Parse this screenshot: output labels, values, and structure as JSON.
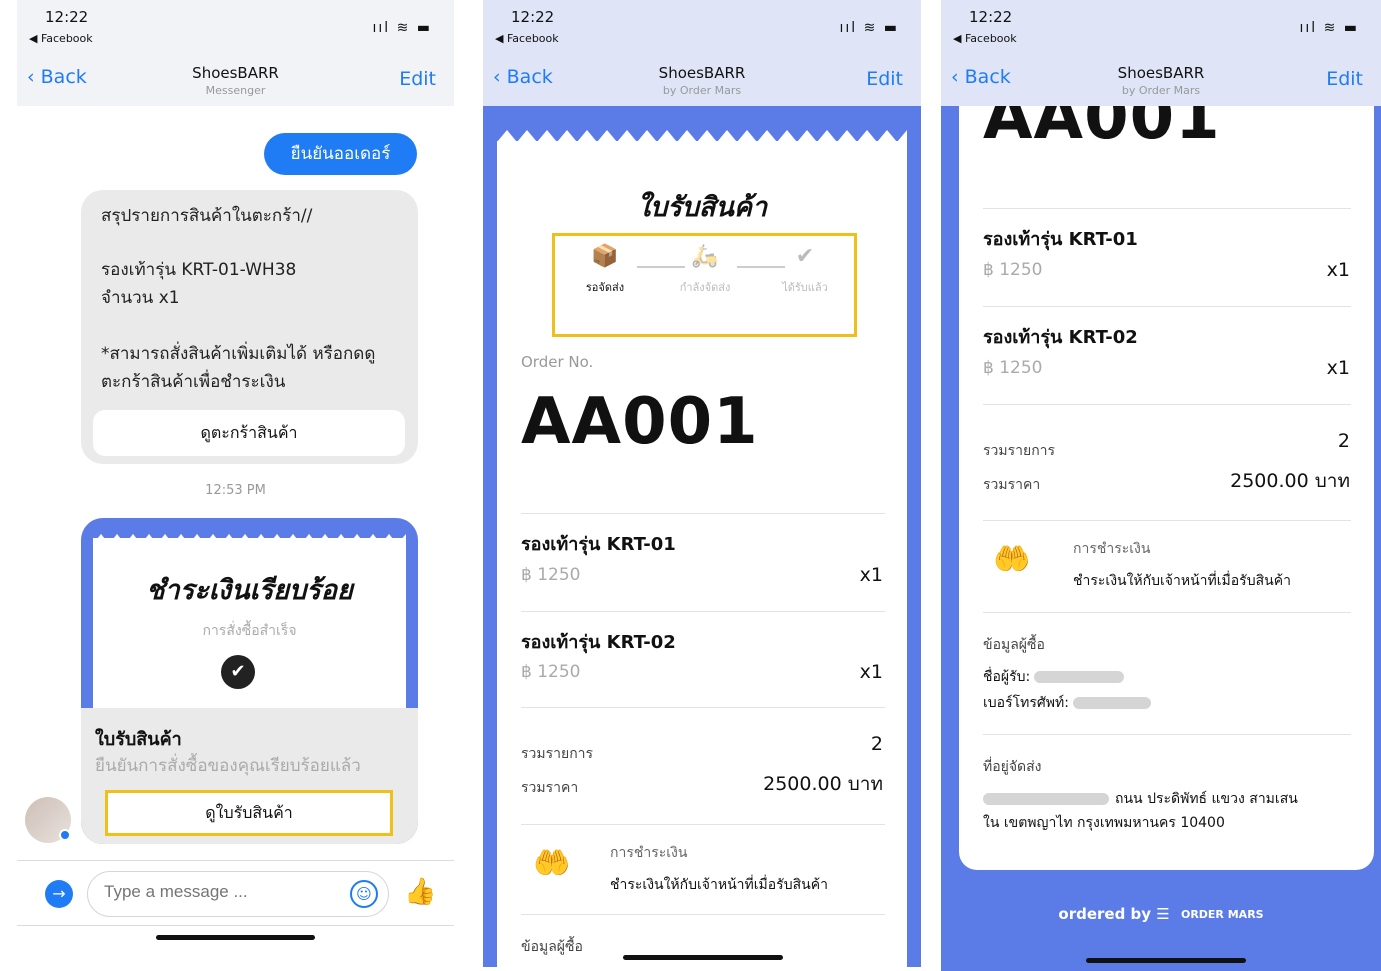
{
  "status": {
    "time": "12:22",
    "back_app": "◀ Facebook",
    "sys_icons": "ııl ≋ ▬"
  },
  "nav": {
    "back": "Back",
    "edit": "Edit",
    "title": "ShoesBARR",
    "sub_messenger": "Messenger",
    "sub_order": "by Order Mars"
  },
  "chat": {
    "sent": "ยืนยันออเดอร์",
    "cart_card": {
      "line1": "สรุปรายการสินค้าในตะกร้า//",
      "line2": "รองเท้ารุ่น KRT-01-WH38",
      "line3": "จำนวน x1",
      "line4": "*สามารถสั่งสินค้าเพิ่มเติมได้ หรือกดดู",
      "line5": "ตะกร้าสินค้าเพื่อชำระเงิน",
      "button": "ดูตะกร้าสินค้า"
    },
    "timestamp": "12:53 PM",
    "receipt_card": {
      "paid": "ชำระเงินเรียบร้อย",
      "paid_sub": "การสั่งซื้อสำเร็จ",
      "title": "ใบรับสินค้า",
      "subtitle": "ยืนยันการสั่งซื้อของคุณเรียบร้อยแล้ว",
      "button": "ดูใบรับสินค้า"
    },
    "input_placeholder": "Type a message ..."
  },
  "receipt": {
    "title": "ใบรับสินค้า",
    "steps": [
      {
        "icon": "box-icon",
        "glyph": "📦",
        "label": "รอจัดส่ง",
        "active": true
      },
      {
        "icon": "scooter-icon",
        "glyph": "🛵",
        "label": "กำลังจัดส่ง",
        "active": false
      },
      {
        "icon": "check-icon",
        "glyph": "✔",
        "label": "ได้รับแล้ว",
        "active": false
      }
    ],
    "order_label": "Order No.",
    "order_no": "AA001",
    "items": [
      {
        "name": "รองเท้ารุ่น KRT-01",
        "price": "฿ 1250",
        "qty": "x1"
      },
      {
        "name": "รองเท้ารุ่น KRT-02",
        "price": "฿ 1250",
        "qty": "x1"
      }
    ],
    "total_items_label": "รวมรายการ",
    "total_items": "2",
    "total_price_label": "รวมราคา",
    "total_price": "2500.00 บาท",
    "payment_label": "การชำระเงิน",
    "payment_value": "ชำระเงินให้กับเจ้าหน้าที่เมื่อรับสินค้า",
    "buyer_label": "ข้อมูลผู้ซื้อ",
    "recipient_label": "ชื่อผู้รับ:",
    "phone_label": "เบอร์โทรศัพท์:",
    "address_label": "ที่อยู่จัดส่ง",
    "address_line1": "ถนน ประดิพัทธ์ แขวง สามเสน",
    "address_line2": "ใน เขตพญาไท กรุงเทพมหานคร 10400",
    "footer_text": "ordered by",
    "footer_logo": "ORDER MARS"
  },
  "colors": {
    "accent_blue": "#1f7cf5",
    "receipt_blue": "#5b7ce6",
    "highlight_yellow": "#f0c01a"
  }
}
